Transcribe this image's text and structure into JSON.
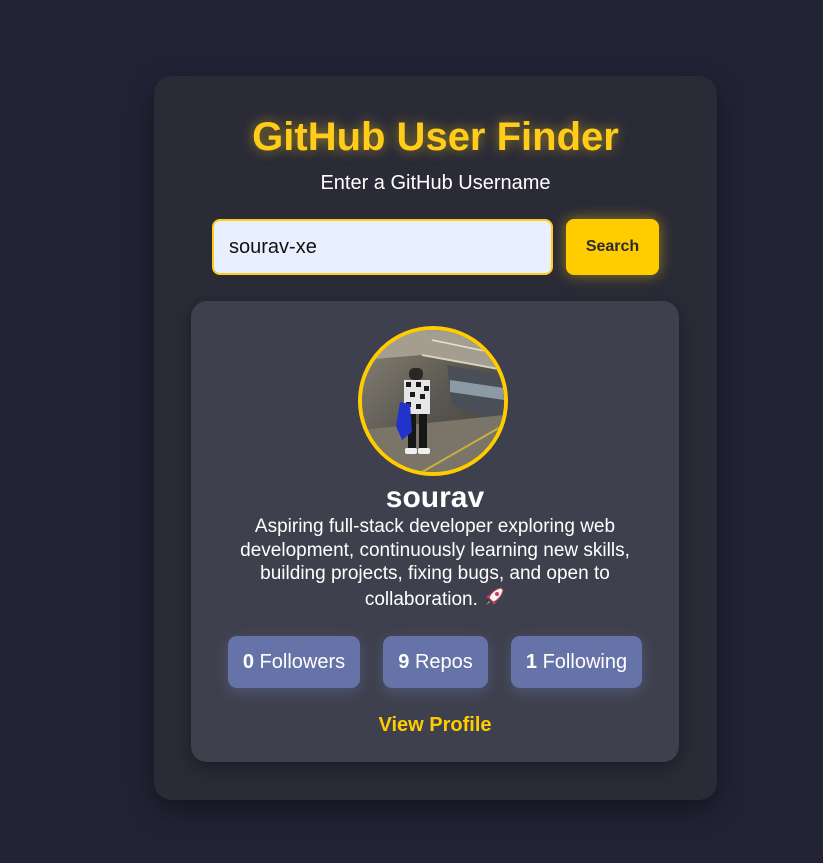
{
  "app": {
    "title": "GitHub User Finder",
    "subtitle": "Enter a GitHub Username"
  },
  "search": {
    "value": "sourav-xe",
    "button_label": "Search"
  },
  "profile": {
    "username": "sourav",
    "bio": "Aspiring full-stack developer exploring web development, continuously learning new skills, building projects, fixing bugs, and open to collaboration.",
    "bio_emoji": "rocket-icon",
    "stats": {
      "followers": {
        "count": "0",
        "label": "Followers"
      },
      "repos": {
        "count": "9",
        "label": "Repos"
      },
      "following": {
        "count": "1",
        "label": "Following"
      }
    },
    "view_profile_label": "View Profile"
  },
  "colors": {
    "page_background": "#222436",
    "container_background": "#2a2b37",
    "card_background": "#3f404d",
    "accent": "#ffcc00",
    "stat_background": "#6673a8",
    "input_background": "#e8efff"
  }
}
